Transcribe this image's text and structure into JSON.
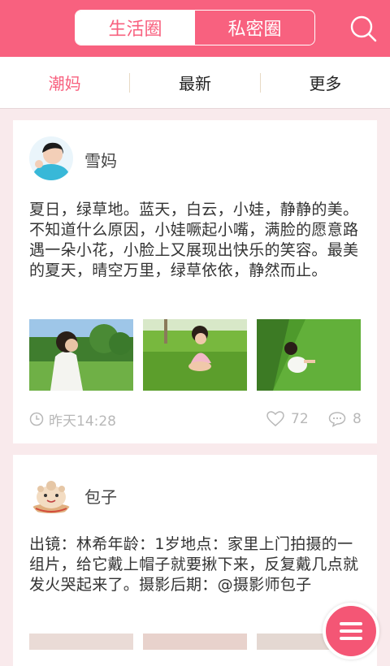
{
  "header": {
    "tabs": [
      {
        "label": "生活圈",
        "active": true
      },
      {
        "label": "私密圈",
        "active": false
      }
    ],
    "search_icon": "search-icon",
    "accent": "#f8617f"
  },
  "subtabs": [
    "潮妈",
    "最新",
    "更多"
  ],
  "posts": [
    {
      "author": "雪妈",
      "text": "夏日，绿草地。蓝天，白云，小娃，静静的美。不知道什么原因，小娃噘起小嘴，满脸的愿意路遇一朵小花，小脸上又展现出快乐的笑容。最美的夏天，晴空万里，绿草依依，静然而止。",
      "time": "昨天14:28",
      "likes": "72",
      "comments": "8"
    },
    {
      "author": "包子",
      "text": "出镜：林希年龄：1岁地点：家里上门拍摄的一组片，给它戴上帽子就要揪下来，反复戴几点就发火哭起来了。摄影后期：@摄影师包子"
    }
  ],
  "fab_icon": "menu-icon"
}
